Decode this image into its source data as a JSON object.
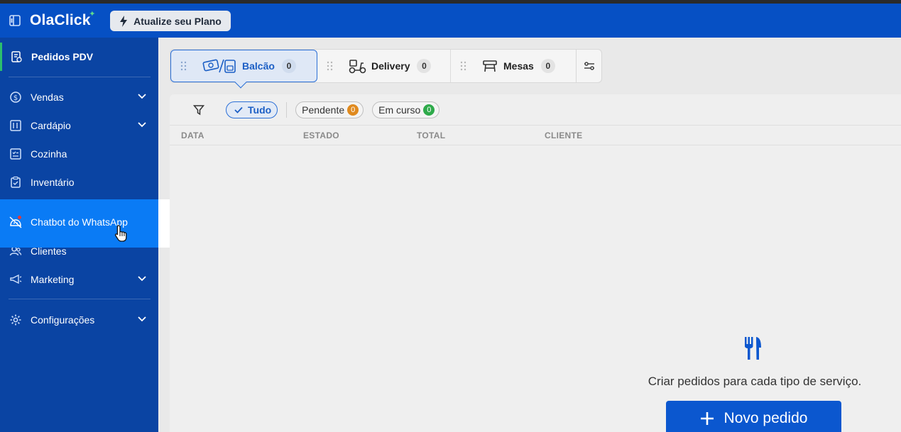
{
  "header": {
    "logo": "OlaClick",
    "upgrade_label": "Atualize seu Plano"
  },
  "sidebar": {
    "top_item": "Pedidos PDV",
    "items": [
      {
        "label": "Vendas",
        "icon": "dollar-circle-icon",
        "has_chevron": true
      },
      {
        "label": "Cardápio",
        "icon": "menu-book-icon",
        "has_chevron": true
      },
      {
        "label": "Cozinha",
        "icon": "kitchen-checklist-icon",
        "has_chevron": false
      },
      {
        "label": "Inventário",
        "icon": "clipboard-check-icon",
        "has_chevron": false
      },
      {
        "label": "Chatbot do WhatsApp",
        "icon": "chatbot-icon",
        "has_chevron": false
      },
      {
        "label": "Clientes",
        "icon": "users-icon",
        "has_chevron": false
      },
      {
        "label": "Marketing",
        "icon": "megaphone-icon",
        "has_chevron": true
      },
      {
        "label": "Configurações",
        "icon": "gear-icon",
        "has_chevron": true
      }
    ]
  },
  "tabs": [
    {
      "label": "Balcão",
      "count": "0",
      "selected": true
    },
    {
      "label": "Delivery",
      "count": "0",
      "selected": false
    },
    {
      "label": "Mesas",
      "count": "0",
      "selected": false
    }
  ],
  "filters": {
    "all": "Tudo",
    "pending": {
      "label": "Pendente",
      "count": "0"
    },
    "in_progress": {
      "label": "Em curso",
      "count": "0"
    }
  },
  "table": {
    "columns": [
      "DATA",
      "ESTADO",
      "TOTAL",
      "CLIENTE"
    ]
  },
  "empty_state": {
    "text": "Criar pedidos para cada tipo de serviço.",
    "button": "Novo pedido"
  },
  "colors": {
    "header": "#0650c4",
    "sidebar": "#0a44a3",
    "highlight": "#0a7bf5",
    "primary": "#0b57cf",
    "pending": "#e08a1e",
    "in_progress": "#2eaa4a"
  }
}
